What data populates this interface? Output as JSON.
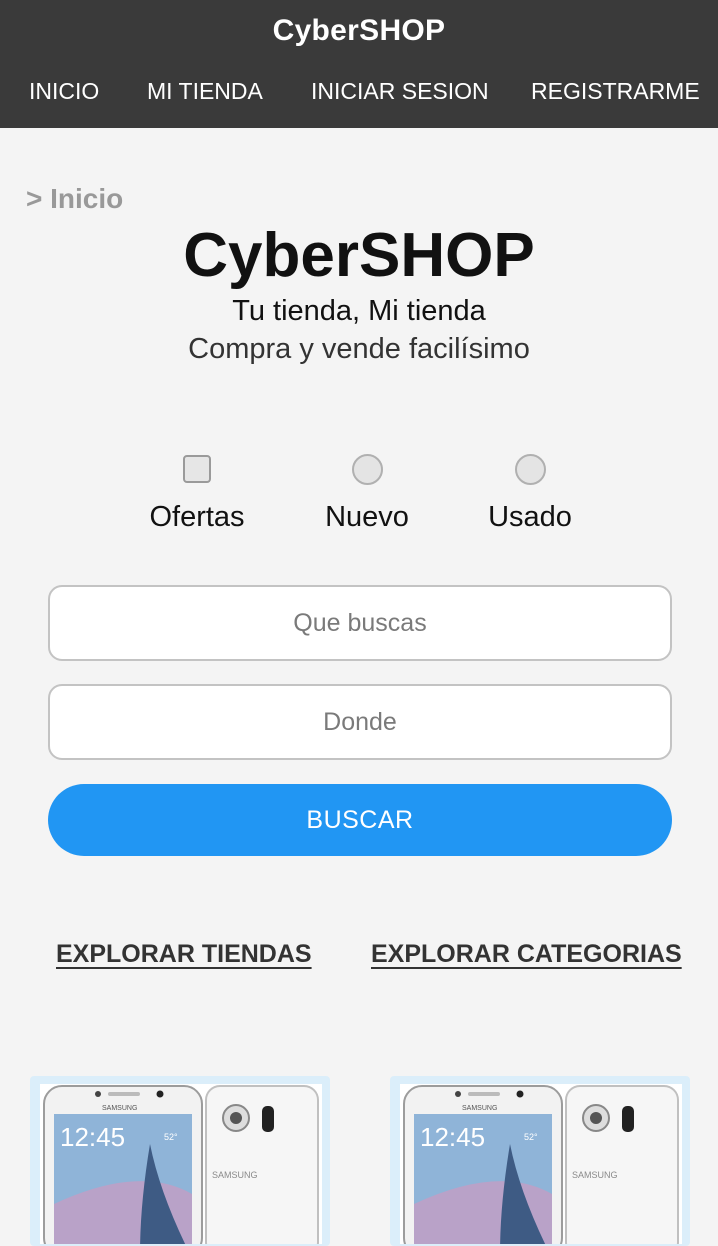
{
  "header": {
    "brand": "CyberSHOP",
    "nav": [
      "INICIO",
      "MI TIENDA",
      "INICIAR SESION",
      "REGISTRARME"
    ]
  },
  "breadcrumb": "> Inicio",
  "hero": {
    "title": "CyberSHOP",
    "subtitle": "Tu tienda, Mi tienda",
    "tagline": "Compra y vende facilísimo"
  },
  "filters": [
    {
      "label": "Ofertas",
      "type": "checkbox",
      "checked": false
    },
    {
      "label": "Nuevo",
      "type": "radio",
      "checked": false
    },
    {
      "label": "Usado",
      "type": "radio",
      "checked": false
    }
  ],
  "search": {
    "what_placeholder": "Que buscas",
    "where_placeholder": "Donde",
    "button_label": "BUSCAR"
  },
  "explore": {
    "stores": "EXPLORAR TIENDAS",
    "categories": "EXPLORAR CATEGORIAS"
  },
  "products": [
    {
      "brand_text": "SAMSUNG",
      "clock": "12:45",
      "weather": "52°"
    },
    {
      "brand_text": "SAMSUNG",
      "clock": "12:45",
      "weather": "52°"
    }
  ],
  "colors": {
    "header_bg": "#3a3a3a",
    "accent": "#2196f3",
    "page_bg": "#f4f4f4"
  }
}
